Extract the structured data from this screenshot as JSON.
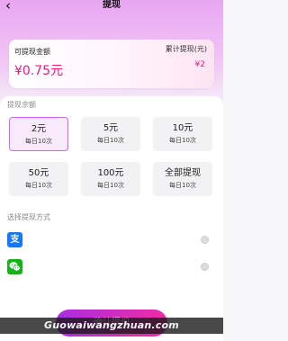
{
  "header": {
    "back_icon": "chevron-left-icon",
    "title": "提现"
  },
  "balance_card": {
    "label": "可提现金额",
    "amount": "¥0.75元",
    "total_label": "累计提现(元)",
    "total_amount": "¥2"
  },
  "amount_section": {
    "title": "提现余额",
    "options": [
      {
        "value": "2元",
        "sub": "每日10次",
        "selected": true
      },
      {
        "value": "5元",
        "sub": "每日10次",
        "selected": false
      },
      {
        "value": "10元",
        "sub": "每日10次",
        "selected": false
      },
      {
        "value": "50元",
        "sub": "每日10次",
        "selected": false
      },
      {
        "value": "100元",
        "sub": "每日10次",
        "selected": false
      },
      {
        "value": "全部提现",
        "sub": "每日10次",
        "selected": false
      }
    ]
  },
  "method_section": {
    "title": "选择提现方式",
    "methods": [
      {
        "icon": "alipay-icon",
        "glyph": "支"
      },
      {
        "icon": "wechat-pay-icon"
      }
    ]
  },
  "submit_button": {
    "label": "确认提现"
  },
  "watermark": {
    "text": "Guowaiwangzhuan.com"
  },
  "colors": {
    "accent": "#f0197d",
    "gradient_start": "#a82ee0",
    "gradient_end": "#f02ba6",
    "alipay": "#1678ff",
    "wechat": "#16b21a"
  }
}
